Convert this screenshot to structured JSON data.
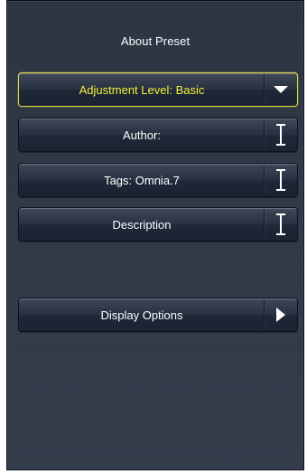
{
  "panel": {
    "title": "About Preset"
  },
  "controls": {
    "adjustment_level": {
      "label": "Adjustment Level: Basic",
      "icon": "dropdown-arrow-icon"
    },
    "author": {
      "label": "Author:",
      "icon": "text-cursor-icon"
    },
    "tags": {
      "label": "Tags: Omnia.7",
      "icon": "text-cursor-icon"
    },
    "description": {
      "label": "Description",
      "icon": "text-cursor-icon"
    },
    "display_options": {
      "label": "Display Options",
      "icon": "chevron-right-icon"
    }
  },
  "colors": {
    "panel_bg": "#2f3746",
    "active_border": "#d8d640",
    "active_text": "#f1ef3c",
    "text": "#ffffff"
  }
}
